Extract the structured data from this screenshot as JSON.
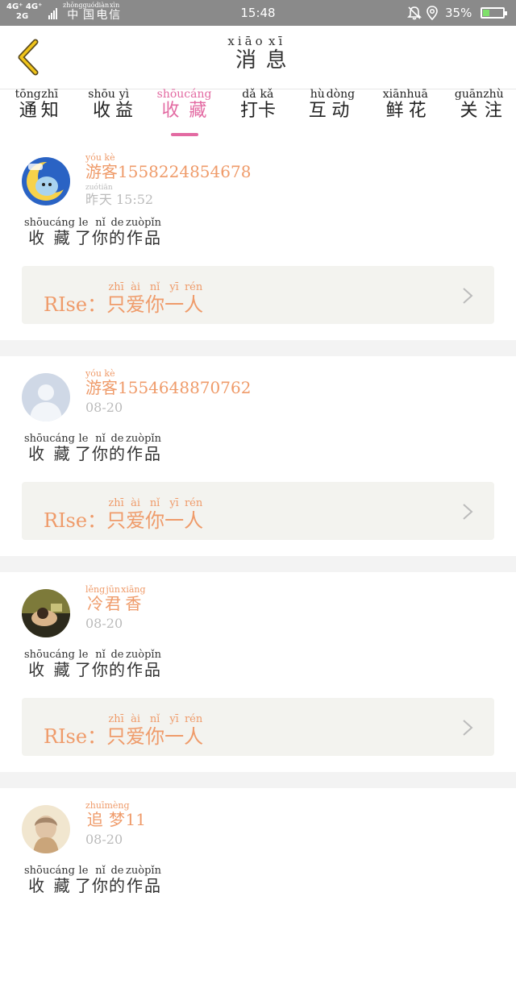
{
  "status_bar": {
    "network": [
      "4G⁺ 4G⁺",
      "2G"
    ],
    "carrier": [
      {
        "c": "中",
        "p": "zhōng"
      },
      {
        "c": "国",
        "p": "guó"
      },
      {
        "c": "电",
        "p": "diàn"
      },
      {
        "c": "信",
        "p": "xìn"
      }
    ],
    "time": "15:48",
    "battery_percent": "35%",
    "battery_level": 0.35,
    "icons": [
      "signal-icon",
      "bell-muted-icon",
      "location-icon",
      "battery-charging-icon"
    ]
  },
  "header": {
    "title": [
      {
        "c": "消",
        "p": "xiāo"
      },
      {
        "c": "息",
        "p": "xī"
      }
    ],
    "back_icon": "chevron-left-icon"
  },
  "tabs": [
    {
      "chars": [
        {
          "c": "通",
          "p": "tōng"
        },
        {
          "c": "知",
          "p": "zhī"
        }
      ],
      "active": false
    },
    {
      "chars": [
        {
          "c": "收",
          "p": "shōu"
        },
        {
          "c": "益",
          "p": "yì"
        }
      ],
      "active": false
    },
    {
      "chars": [
        {
          "c": "收",
          "p": "shōu"
        },
        {
          "c": "藏",
          "p": "cáng"
        }
      ],
      "active": true
    },
    {
      "chars": [
        {
          "c": "打",
          "p": "dǎ"
        },
        {
          "c": "卡",
          "p": "kǎ"
        }
      ],
      "active": false
    },
    {
      "chars": [
        {
          "c": "互",
          "p": "hù"
        },
        {
          "c": "动",
          "p": "dòng"
        }
      ],
      "active": false
    },
    {
      "chars": [
        {
          "c": "鲜",
          "p": "xiān"
        },
        {
          "c": "花",
          "p": "huā"
        }
      ],
      "active": false
    },
    {
      "chars": [
        {
          "c": "关",
          "p": "guān"
        },
        {
          "c": "注",
          "p": "zhù"
        }
      ],
      "active": false
    }
  ],
  "colors": {
    "accent": "#e36aa2",
    "name": "#ef9b6a",
    "card_bg": "#f3f3ef",
    "separator": "#f3f3f3",
    "status_bar": "#8a8a8a"
  },
  "action_text": [
    {
      "c": "收",
      "p": "shōu"
    },
    {
      "c": "藏",
      "p": "cáng"
    },
    {
      "c": "了",
      "p": "le"
    },
    {
      "c": "你",
      "p": "nǐ"
    },
    {
      "c": "的",
      "p": "de"
    },
    {
      "c": "作",
      "p": "zuò"
    },
    {
      "c": "品",
      "p": "pǐn"
    }
  ],
  "messages": [
    {
      "avatar": "cartoon-moon-avatar",
      "name": [
        {
          "c": "游",
          "p": "yóu"
        },
        {
          "c": "客",
          "p": "kè"
        }
      ],
      "name_suffix": "15582248546​78",
      "time": [
        {
          "c": "昨",
          "p": "zuó"
        },
        {
          "c": "天",
          "p": "tiān"
        }
      ],
      "time_suffix": "15:52",
      "work_prefix": "RIse：",
      "work": [
        {
          "c": "只",
          "p": "zhī"
        },
        {
          "c": "爱",
          "p": "ài"
        },
        {
          "c": "你",
          "p": "nǐ"
        },
        {
          "c": "一",
          "p": "yī"
        },
        {
          "c": "人",
          "p": "rén"
        }
      ]
    },
    {
      "avatar": "default-user-avatar",
      "name": [
        {
          "c": "游",
          "p": "yóu"
        },
        {
          "c": "客",
          "p": "kè"
        }
      ],
      "name_suffix": "1554648870762",
      "time": [],
      "time_suffix": "08-20",
      "work_prefix": "RIse：",
      "work": [
        {
          "c": "只",
          "p": "zhī"
        },
        {
          "c": "爱",
          "p": "ài"
        },
        {
          "c": "你",
          "p": "nǐ"
        },
        {
          "c": "一",
          "p": "yī"
        },
        {
          "c": "人",
          "p": "rén"
        }
      ]
    },
    {
      "avatar": "photo-avatar-dark",
      "name": [
        {
          "c": "冷",
          "p": "lěng"
        },
        {
          "c": "君",
          "p": "jūn"
        },
        {
          "c": "香",
          "p": "xiāng"
        }
      ],
      "name_suffix": "",
      "time": [],
      "time_suffix": "08-20",
      "work_prefix": "RIse：",
      "work": [
        {
          "c": "只",
          "p": "zhī"
        },
        {
          "c": "爱",
          "p": "ài"
        },
        {
          "c": "你",
          "p": "nǐ"
        },
        {
          "c": "一",
          "p": "yī"
        },
        {
          "c": "人",
          "p": "rén"
        }
      ]
    },
    {
      "avatar": "photo-avatar-light",
      "name": [
        {
          "c": "追",
          "p": "zhuī"
        },
        {
          "c": "梦",
          "p": "mèng"
        }
      ],
      "name_suffix": "11",
      "time": [],
      "time_suffix": "08-20",
      "work_prefix": "",
      "work": []
    }
  ]
}
